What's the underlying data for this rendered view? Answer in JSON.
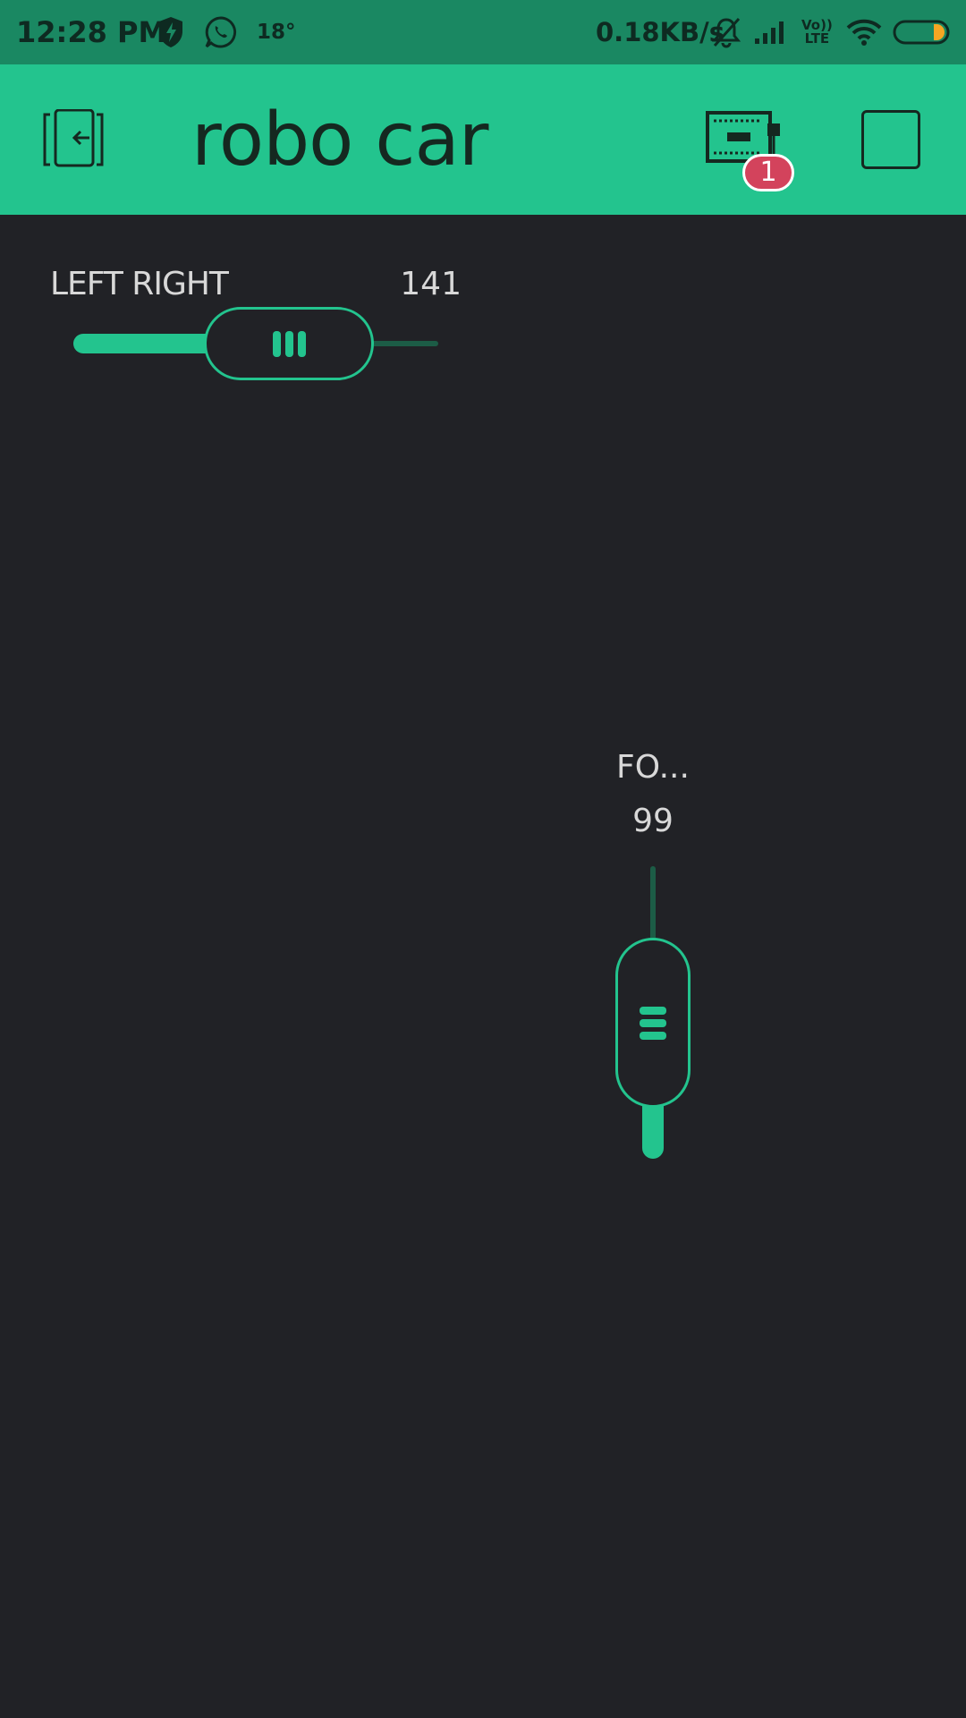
{
  "status_bar": {
    "time": "12:28 PM",
    "temperature": "18°",
    "net_speed": "0.18KB/s",
    "volte_top": "Vo))",
    "volte_bottom": "LTE",
    "icons": [
      "shield-bolt-icon",
      "whatsapp-icon",
      "bell-off-icon",
      "signal-icon",
      "wifi-icon",
      "battery-icon"
    ]
  },
  "app_bar": {
    "title": "robo car",
    "device_badge_count": "1",
    "icons": [
      "exit-icon",
      "device-board-icon",
      "play-square-icon"
    ]
  },
  "widgets": {
    "h_slider": {
      "label": "LEFT RIGHT",
      "value": "141"
    },
    "v_slider": {
      "label": "FO...",
      "value": "99"
    }
  },
  "colors": {
    "accent": "#23c48e",
    "status_bar": "#1a8862",
    "background": "#212226",
    "badge": "#d3435c",
    "battery_dot": "#f5a623"
  }
}
